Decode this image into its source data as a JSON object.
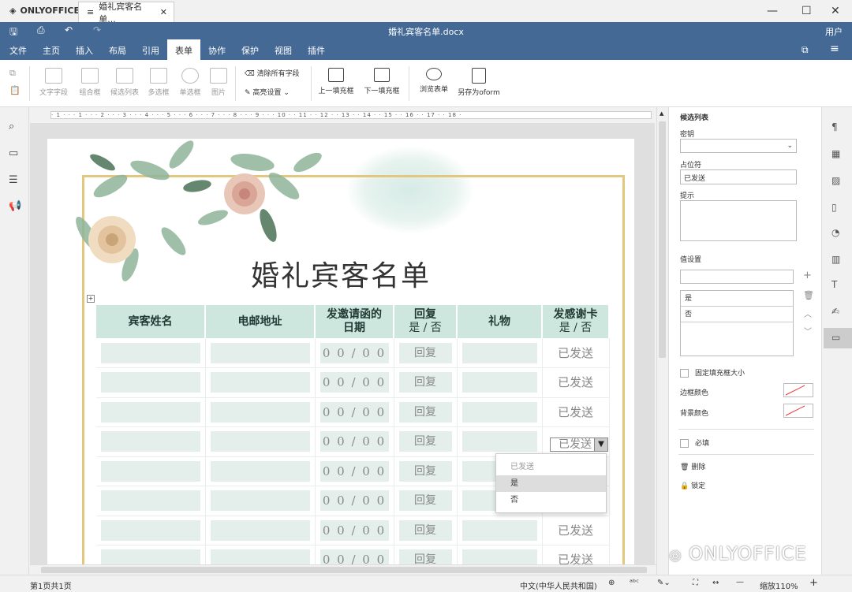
{
  "app": {
    "name": "ONLYOFFICE",
    "tab": "婚礼宾客名单...",
    "title": "婚礼宾客名单.docx",
    "user": "用户"
  },
  "menu": [
    "文件",
    "主页",
    "插入",
    "布局",
    "引用",
    "表单",
    "协作",
    "保护",
    "视图",
    "插件"
  ],
  "menu_active": "表单",
  "toolbar": {
    "text_field": "文字字段",
    "combo": "组合框",
    "dropdown": "候选列表",
    "checkbox": "多选框",
    "radio": "单选框",
    "image": "图片",
    "clear": "清除所有字段",
    "highlight": "高亮设置",
    "prev": "上一填充框",
    "next": "下一填充框",
    "view": "浏览表单",
    "save_oform": "另存为oform"
  },
  "ruler": "· 1 · · · 1 · · · 2 · · · 3 · · · 4 · · · 5 · · · 6 · · · 7 · · · 8 · · · 9 · · · 10 · · 11 · · 12 · · 13 · · 14 · · 15 · · 16 · · 17 · · 18 ·",
  "document": {
    "title": "婚礼宾客名单",
    "headers": [
      "宾客姓名",
      "电邮地址",
      "发邀请函的",
      "日期",
      "回复",
      "是 / 否",
      "礼物",
      "发感谢卡",
      "是 / 否"
    ],
    "date_placeholder": "0 0 / 0 0",
    "reply": "回复",
    "sent": "已发送"
  },
  "dropdown": {
    "current": "已发送",
    "options": [
      "已发送",
      "是",
      "否"
    ],
    "selected": "是"
  },
  "panel": {
    "title": "候选列表",
    "key": "密钥",
    "placeholder": "占位符",
    "placeholder_value": "已发送",
    "tip": "提示",
    "value_settings": "值设置",
    "values": [
      "是",
      "否"
    ],
    "fixed": "固定填充框大小",
    "border_color": "边框颜色",
    "bg_color": "背景颜色",
    "required": "必填",
    "delete": "删除",
    "lock": "锁定"
  },
  "status": {
    "page": "第1页共1页",
    "lang": "中文(中华人民共和国)",
    "zoom": "缩放110%"
  },
  "watermark": "ONLYOFFICE"
}
